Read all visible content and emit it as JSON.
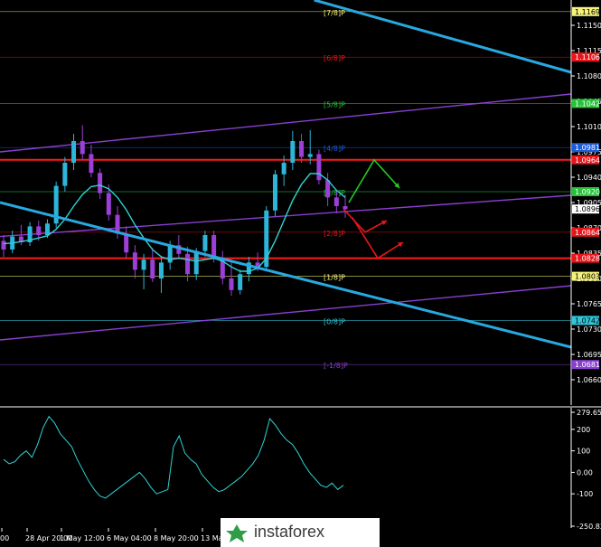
{
  "chart_data": [
    {
      "type": "candlestick",
      "symbol_pair_note": "",
      "price_axis": {
        "ylim": [
          1.0625,
          1.1185
        ],
        "ticks": [
          "1.1150",
          "1.1115",
          "1.1080",
          "1.1045",
          "1.1010",
          "1.0975",
          "1.0940",
          "1.0905",
          "1.0870",
          "1.0835",
          "1.0800",
          "1.0765",
          "1.0730",
          "1.0695",
          "1.0660"
        ],
        "tick_values": [
          1.115,
          1.1115,
          1.108,
          1.1045,
          1.101,
          1.0975,
          1.094,
          1.0905,
          1.087,
          1.0835,
          1.08,
          1.0765,
          1.073,
          1.0695,
          1.066
        ]
      },
      "time_axis": {
        "labels": [
          "00",
          "28 Apr 20:00",
          "1 May 12:00",
          "6 May 04:00",
          "8 May 20:00",
          "13 Ma"
        ]
      },
      "murrey_levels": [
        {
          "label": "[7/8]P",
          "value": 1.1169,
          "tag": "1.1169",
          "color": "#f4f27a",
          "tag_bg": "#f4f27a",
          "tag_fg": "#000000"
        },
        {
          "label": "[6/8]P",
          "value": 1.1106,
          "tag": "1.1106",
          "color": "#e8161b",
          "tag_bg": "#e8161b",
          "tag_fg": "#ffffff"
        },
        {
          "label": "[5/8]P",
          "value": 1.1042,
          "tag": "1.1042",
          "color": "#27c23a",
          "tag_bg": "#27c23a",
          "tag_fg": "#ffffff"
        },
        {
          "label": "[4/8]P",
          "value": 1.0981,
          "tag": "1.0981",
          "color": "#1f5bd6",
          "tag_bg": "#1f5bd6",
          "tag_fg": "#ffffff"
        },
        {
          "label": "[3/8]P",
          "value": 1.092,
          "tag": "1.0920",
          "color": "#27c23a",
          "tag_bg": "#27c23a",
          "tag_fg": "#ffffff"
        },
        {
          "label": "[2/8]P",
          "value": 1.0864,
          "tag": "1.0864",
          "color": "#e8161b",
          "tag_bg": "#e8161b",
          "tag_fg": "#ffffff"
        },
        {
          "label": "[1/8]P",
          "value": 1.0803,
          "tag": "1.0803",
          "color": "#f4f27a",
          "tag_bg": "#f4f27a",
          "tag_fg": "#000000"
        },
        {
          "label": "[0/8]P",
          "value": 1.0742,
          "tag": "1.0742",
          "color": "#31c6d8",
          "tag_bg": "#31c6d8",
          "tag_fg": "#000000"
        },
        {
          "label": "[-1/8]P",
          "value": 1.0681,
          "tag": "1.0681",
          "color": "#8a3fd1",
          "tag_bg": "#8a3fd1",
          "tag_fg": "#ffffff"
        }
      ],
      "extra_tags": [
        {
          "value": 1.0964,
          "tag": "1.0964",
          "bg": "#e8161b",
          "fg": "#ffffff"
        },
        {
          "value": 1.0896,
          "tag": "1.0896",
          "bg": "#ffffff",
          "fg": "#000000"
        },
        {
          "value": 1.0828,
          "tag": "1.0828",
          "bg": "#e8161b",
          "fg": "#ffffff"
        }
      ],
      "horizontal_lines": [
        {
          "value": 1.0964,
          "color": "#ff1a1a",
          "width": 2
        },
        {
          "value": 1.0828,
          "color": "#ff1a1a",
          "width": 2
        }
      ],
      "channel_lines": [
        {
          "color": "#8a3fd1",
          "from": [
            0,
            1.0975
          ],
          "to": [
            1,
            1.1055
          ]
        },
        {
          "color": "#8a3fd1",
          "from": [
            0,
            1.0858
          ],
          "to": [
            1,
            1.0915
          ]
        },
        {
          "color": "#8a3fd1",
          "from": [
            0,
            1.0715
          ],
          "to": [
            1,
            1.079
          ]
        }
      ],
      "trend_lines": [
        {
          "color": "#29a8e0",
          "from": [
            0.55,
            1.1185
          ],
          "to": [
            1,
            1.1085
          ]
        },
        {
          "color": "#29a8e0",
          "from": [
            0,
            1.0905
          ],
          "to": [
            1,
            1.0705
          ]
        }
      ],
      "candles": [
        [
          1.0852,
          1.086,
          1.083,
          1.084
        ],
        [
          1.084,
          1.0866,
          1.0835,
          1.0858
        ],
        [
          1.0858,
          1.0874,
          1.0846,
          1.085
        ],
        [
          1.085,
          1.0878,
          1.0845,
          1.0872
        ],
        [
          1.0872,
          1.088,
          1.0852,
          1.086
        ],
        [
          1.086,
          1.0882,
          1.0856,
          1.0876
        ],
        [
          1.0876,
          1.0934,
          1.087,
          1.0928
        ],
        [
          1.0928,
          1.0968,
          1.092,
          1.096
        ],
        [
          1.096,
          1.1,
          1.095,
          1.099
        ],
        [
          1.099,
          1.1012,
          1.0965,
          1.0972
        ],
        [
          1.0972,
          1.0985,
          1.094,
          1.0946
        ],
        [
          1.0946,
          1.0952,
          1.091,
          1.0918
        ],
        [
          1.0918,
          1.093,
          1.088,
          1.0888
        ],
        [
          1.0888,
          1.09,
          1.0855,
          1.0862
        ],
        [
          1.0862,
          1.0872,
          1.0828,
          1.0836
        ],
        [
          1.0836,
          1.0846,
          1.08,
          1.0812
        ],
        [
          1.0812,
          1.0834,
          1.0785,
          1.0826
        ],
        [
          1.0826,
          1.0842,
          1.0795,
          1.08
        ],
        [
          1.08,
          1.083,
          1.078,
          1.0822
        ],
        [
          1.0822,
          1.0852,
          1.0812,
          1.0846
        ],
        [
          1.0846,
          1.086,
          1.0828,
          1.0834
        ],
        [
          1.0834,
          1.0844,
          1.0796,
          1.0806
        ],
        [
          1.0806,
          1.0842,
          1.0798,
          1.0838
        ],
        [
          1.0838,
          1.0866,
          1.083,
          1.086
        ],
        [
          1.086,
          1.0866,
          1.0822,
          1.0828
        ],
        [
          1.0828,
          1.0838,
          1.0792,
          1.08
        ],
        [
          1.08,
          1.0826,
          1.0776,
          1.0784
        ],
        [
          1.0784,
          1.0812,
          1.0778,
          1.0806
        ],
        [
          1.0806,
          1.083,
          1.0796,
          1.0822
        ],
        [
          1.0822,
          1.0836,
          1.081,
          1.0816
        ],
        [
          1.0816,
          1.09,
          1.081,
          1.0894
        ],
        [
          1.0894,
          1.095,
          1.0886,
          1.0944
        ],
        [
          1.0944,
          1.097,
          1.0928,
          1.096
        ],
        [
          1.096,
          1.1004,
          1.095,
          1.099
        ],
        [
          1.099,
          1.1,
          1.096,
          1.0968
        ],
        [
          1.0968,
          1.1005,
          1.0958,
          1.0972
        ],
        [
          1.0972,
          1.0978,
          1.093,
          1.0936
        ],
        [
          1.0936,
          1.0946,
          1.09,
          1.0912
        ],
        [
          1.0912,
          1.0922,
          1.089,
          1.09
        ],
        [
          1.09,
          1.0916,
          1.0884,
          1.0896
        ]
      ],
      "moving_average": [
        1.0848,
        1.0849,
        1.0851,
        1.0853,
        1.0856,
        1.0859,
        1.0868,
        1.0882,
        1.09,
        1.0916,
        1.0927,
        1.0929,
        1.0924,
        1.0912,
        1.0895,
        1.0874,
        1.0856,
        1.084,
        1.083,
        1.0826,
        1.0828,
        1.0826,
        1.0824,
        1.0826,
        1.0828,
        1.0824,
        1.0816,
        1.081,
        1.081,
        1.0814,
        1.0828,
        1.0852,
        1.088,
        1.0908,
        1.093,
        1.0945,
        1.0945,
        1.0936,
        1.0922,
        1.0912
      ],
      "forecast_arrows": [
        {
          "color": "#22cc22",
          "points": [
            [
              1.0905,
              0
            ],
            [
              1.0964,
              1
            ],
            [
              1.0925,
              2
            ]
          ]
        },
        {
          "color": "#e8161b",
          "points": [
            [
              1.0896,
              0
            ],
            [
              1.0864,
              1
            ],
            [
              1.088,
              2
            ]
          ]
        },
        {
          "color": "#e8161b",
          "points": [
            [
              1.0884,
              0
            ],
            [
              1.0828,
              1
            ],
            [
              1.085,
              2
            ]
          ]
        }
      ]
    },
    {
      "type": "line",
      "name": "oscillator",
      "ylim": [
        -250.834,
        279.6586
      ],
      "ticks": [
        "279.6586",
        "200",
        "100",
        "0.00",
        "-100",
        "-250.834"
      ],
      "tick_values": [
        279.6586,
        200,
        100,
        0,
        -100,
        -250.834
      ],
      "values": [
        60,
        40,
        50,
        80,
        100,
        70,
        130,
        210,
        260,
        230,
        180,
        150,
        120,
        60,
        10,
        -40,
        -80,
        -110,
        -120,
        -100,
        -80,
        -60,
        -40,
        -20,
        0,
        -30,
        -70,
        -100,
        -90,
        -80,
        120,
        170,
        90,
        60,
        40,
        -10,
        -40,
        -70,
        -90,
        -80,
        -60,
        -40,
        -20,
        10,
        40,
        80,
        150,
        250,
        220,
        180,
        150,
        130,
        90,
        40,
        0,
        -30,
        -60,
        -70,
        -50,
        -80,
        -60
      ]
    }
  ],
  "branding": {
    "logo_text": "instaforex"
  }
}
